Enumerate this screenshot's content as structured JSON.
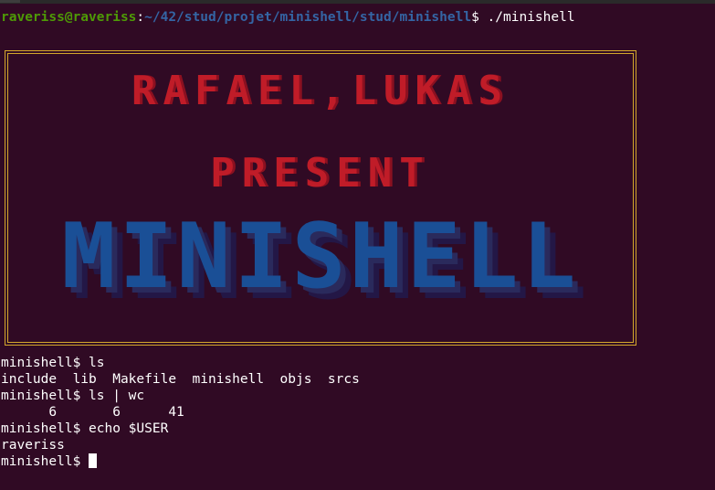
{
  "prompt": {
    "user_host": "raveriss@raveriss",
    "sep": ":",
    "path": "~/42/stud/projet/minishell/stud/minishell",
    "dollar": "$ ",
    "command": "./minishell"
  },
  "banner": {
    "line1": "RAFAEL,LUKAS",
    "line2": "PRESENT",
    "title": "MINISHELL"
  },
  "session": {
    "shell_prompt": "minishell$ ",
    "lines": [
      {
        "prompt": "minishell$ ",
        "text": "ls"
      },
      {
        "prompt": "",
        "text": "include  lib  Makefile  minishell  objs  srcs"
      },
      {
        "prompt": "minishell$ ",
        "text": "ls | wc"
      },
      {
        "prompt": "",
        "text": "      6       6      41"
      },
      {
        "prompt": "minishell$ ",
        "text": "echo $USER"
      },
      {
        "prompt": "",
        "text": "raveriss"
      }
    ]
  }
}
